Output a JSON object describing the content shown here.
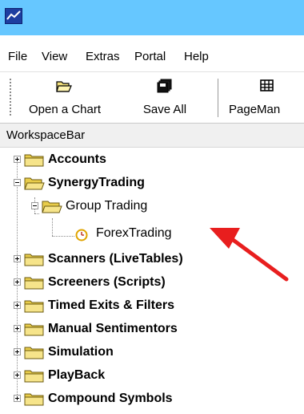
{
  "menu": {
    "items": [
      {
        "label": "File"
      },
      {
        "label": "View"
      },
      {
        "label": "Extras"
      },
      {
        "label": "Portal"
      },
      {
        "label": "Help"
      }
    ]
  },
  "toolbar": {
    "open_chart_label": "Open a Chart",
    "save_all_label": "Save All",
    "pagemanager_label": "PageMan"
  },
  "workspace_bar": {
    "title": "WorkspaceBar"
  },
  "tree": {
    "accounts": "Accounts",
    "synergy": "SynergyTrading",
    "group": "Group Trading",
    "forex": "ForexTrading",
    "scanners": "Scanners (LiveTables)",
    "screeners": "Screeners (Scripts)",
    "timed_exits": "Timed Exits & Filters",
    "manual": "Manual Sentimentors",
    "simulation": "Simulation",
    "playback": "PlayBack",
    "compound": "Compound Symbols"
  },
  "colors": {
    "titlebar": "#66c7ff",
    "folder": "#f3e07a",
    "arrow": "#e81e1e",
    "clock": "#e0a400"
  }
}
